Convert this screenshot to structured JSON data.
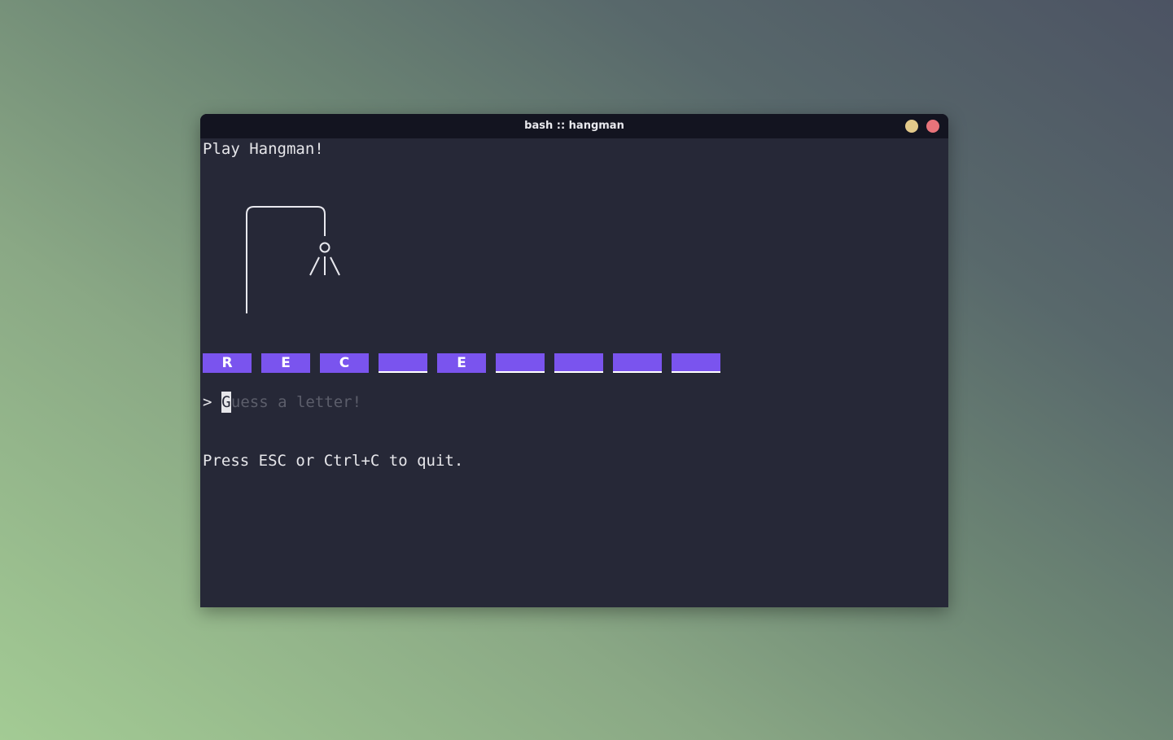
{
  "window": {
    "title": "bash :: hangman",
    "buttons": [
      "minimize",
      "close"
    ],
    "colors": {
      "minimize": "#e3c98a",
      "close": "#e8737a",
      "accent": "#7a54ee",
      "background": "#262837"
    }
  },
  "game": {
    "heading": "Play Hangman!",
    "hangman_parts_drawn": [
      "head",
      "body",
      "left-arm",
      "right-arm"
    ],
    "tiles": [
      "R",
      "E",
      "C",
      "",
      "E",
      "",
      "",
      "",
      ""
    ],
    "input": {
      "prompt": ">",
      "value": "",
      "placeholder_first": "G",
      "placeholder_rest": "uess a letter!"
    },
    "quit_hint": "Press ESC or Ctrl+C to quit."
  }
}
